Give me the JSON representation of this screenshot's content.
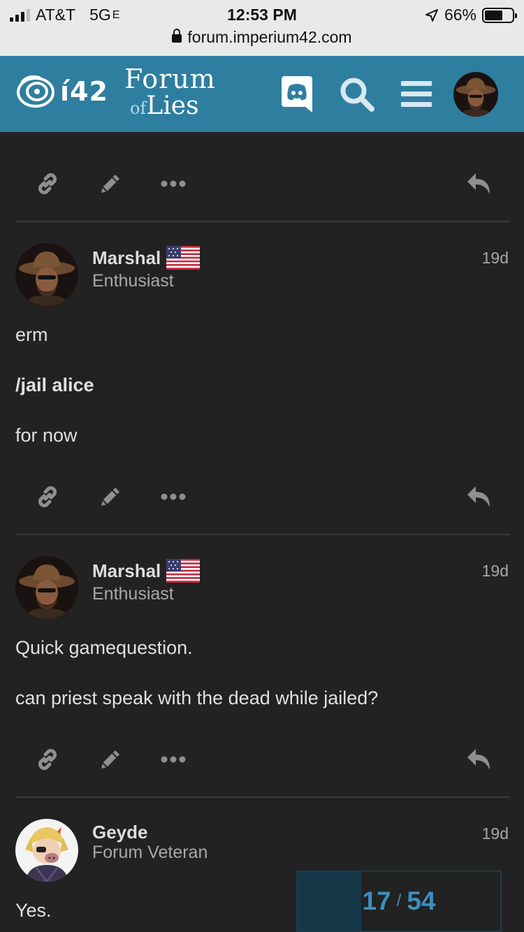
{
  "status_bar": {
    "carrier": "AT&T",
    "network": "5G",
    "network_suffix": "E",
    "time": "12:53 PM",
    "battery": "66%",
    "battery_level": 0.66,
    "url": "forum.imperium42.com"
  },
  "header": {
    "logo_short": "í42",
    "logo_title_line1": "Forum",
    "logo_title_of": "of",
    "logo_title_line2": "Lies",
    "brand_color": "#2e7ea0"
  },
  "posts": [
    {
      "username": "Marshal",
      "user_title": "Enthusiast",
      "date": "19d",
      "lines": [
        "erm",
        "/jail alice",
        "for now"
      ]
    },
    {
      "username": "Marshal",
      "user_title": "Enthusiast",
      "date": "19d",
      "lines": [
        "Quick gamequestion.",
        "can priest speak with the dead while jailed?"
      ]
    },
    {
      "username": "Geyde",
      "user_title": "Forum Veteran",
      "date": "19d",
      "lines": [
        "Yes."
      ]
    }
  ],
  "progress": {
    "current": "17",
    "separator": "/",
    "total": "54",
    "fraction": 0.3148
  }
}
